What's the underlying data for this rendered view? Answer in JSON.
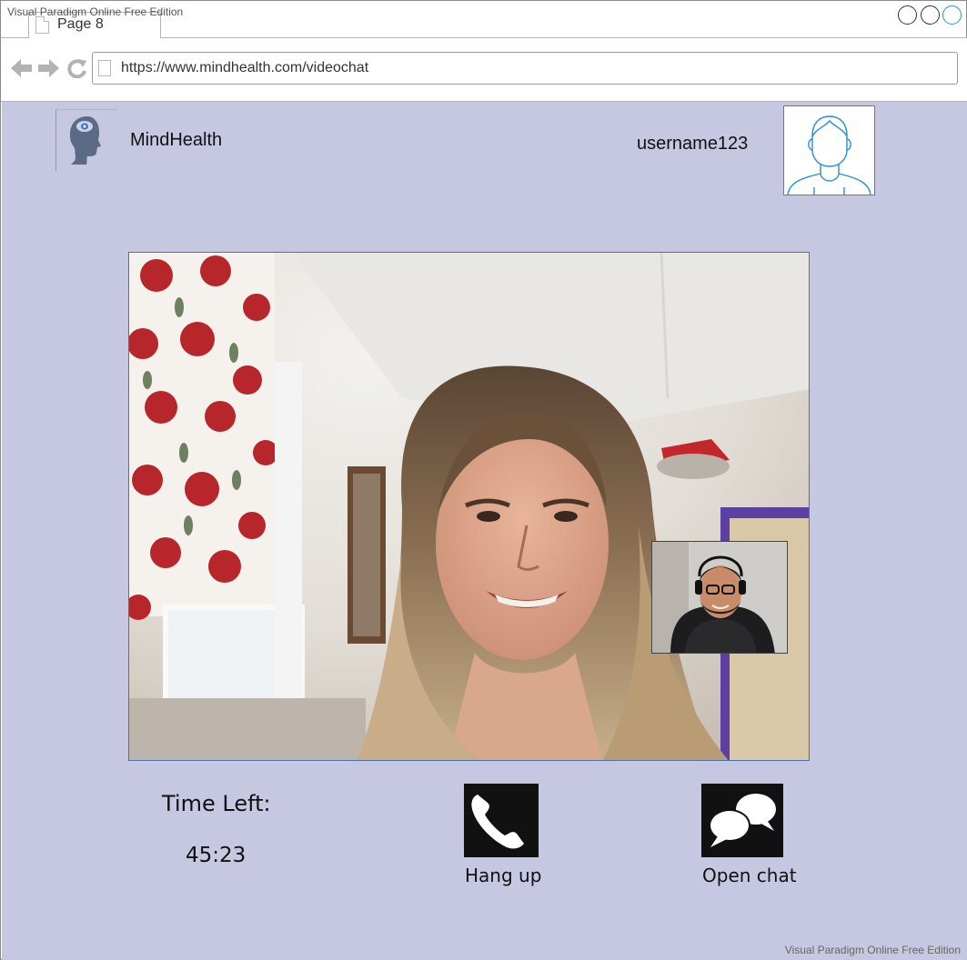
{
  "editor": {
    "watermark": "Visual Paradigm Online Free Edition"
  },
  "browser": {
    "tab_label": "Page 8",
    "url": "https://www.mindhealth.com/videochat"
  },
  "header": {
    "brand": "MindHealth",
    "username": "username123"
  },
  "call": {
    "time_left_label": "Time Left:",
    "time_left_value": "45:23",
    "hangup_label": "Hang up",
    "chat_label": "Open chat"
  },
  "colors": {
    "page_background": "#c5c8e0",
    "avatar_stroke": "#2a8fd8",
    "button_fill": "#111111"
  },
  "icons": {
    "logo": "head-brain-icon",
    "avatar": "user-avatar-icon",
    "hangup": "phone-icon",
    "chat": "speech-bubbles-icon"
  }
}
